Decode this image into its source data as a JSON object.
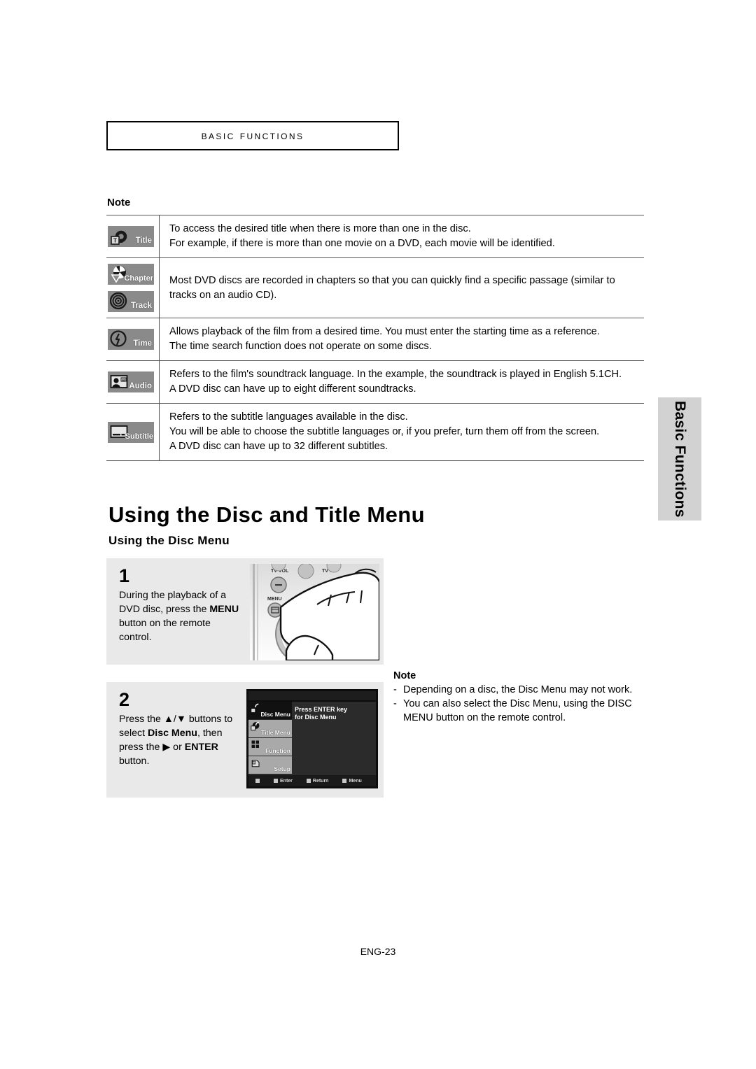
{
  "chapter": {
    "title": "Basic Functions"
  },
  "note_table": {
    "label": "Note",
    "rows": [
      {
        "icons": [
          {
            "name": "title-icon",
            "label": "Title"
          }
        ],
        "lines": [
          "To access the desired title when there is more than one in the disc.",
          "For example, if there is more than one movie on a DVD, each movie will be identified."
        ]
      },
      {
        "icons": [
          {
            "name": "chapter-icon",
            "label": "Chapter"
          },
          {
            "name": "track-icon",
            "label": "Track"
          }
        ],
        "lines": [
          "Most DVD discs are recorded in chapters so that you can quickly find a specific passage (similar to",
          "tracks on an audio CD)."
        ]
      },
      {
        "icons": [
          {
            "name": "time-icon",
            "label": "Time"
          }
        ],
        "lines": [
          "Allows playback of the film from a desired time. You must enter the starting time as a reference.",
          "The time search function does not operate on some discs."
        ]
      },
      {
        "icons": [
          {
            "name": "audio-icon",
            "label": "Audio"
          }
        ],
        "lines": [
          "Refers to the film's soundtrack language. In the example, the soundtrack is played in English 5.1CH.",
          "A DVD disc can have up to eight different soundtracks."
        ]
      },
      {
        "icons": [
          {
            "name": "subtitle-icon",
            "label": "Subtitle"
          }
        ],
        "lines": [
          "Refers to the subtitle languages available in the disc.",
          "You will be able to choose the subtitle languages or, if you prefer, turn them off from the screen.",
          "A DVD disc can have up to 32 different subtitles."
        ]
      }
    ]
  },
  "section": {
    "heading": "Using the Disc and Title Menu",
    "subheading": "Using the Disc Menu"
  },
  "steps": [
    {
      "number": "1",
      "text_parts": [
        {
          "t": "During the playback of a DVD disc, press the ",
          "b": false
        },
        {
          "t": "MENU",
          "b": true
        },
        {
          "t": " button on the remote control.",
          "b": false
        }
      ],
      "image_name": "remote-control-menu-button-photo",
      "remote_labels": {
        "tv_vol": "TV VOL",
        "tv_ch": "TV CH",
        "menu": "MENU"
      }
    },
    {
      "number": "2",
      "text_parts": [
        {
          "t": "Press the ",
          "b": false
        },
        {
          "t": "▲",
          "b": false
        },
        {
          "t": "/",
          "b": false
        },
        {
          "t": "▼",
          "b": false
        },
        {
          "t": " buttons to select ",
          "b": false
        },
        {
          "t": "Disc Menu",
          "b": true
        },
        {
          "t": ", then press the ",
          "b": false
        },
        {
          "t": "▶",
          "b": false
        },
        {
          "t": " or ",
          "b": false
        },
        {
          "t": "ENTER",
          "b": true
        },
        {
          "t": " button.",
          "b": false
        }
      ],
      "image_name": "dvd-osd-menu-screenshot"
    }
  ],
  "tv_menu": {
    "items": [
      {
        "label": "Disc Menu",
        "active": true,
        "icon": "disc-menu-icon"
      },
      {
        "label": "Title Menu",
        "active": false,
        "icon": "title-menu-icon"
      },
      {
        "label": "Function",
        "active": false,
        "icon": "function-icon"
      },
      {
        "label": "Setup",
        "active": false,
        "icon": "setup-icon"
      }
    ],
    "panel_lines": [
      "Press ENTER key",
      "for Disc Menu"
    ],
    "hints": [
      "Enter",
      "Return",
      "Menu"
    ]
  },
  "side_note": {
    "title": "Note",
    "items": [
      "Depending on a disc, the Disc Menu may not work.",
      "You can also select the Disc Menu, using the DISC MENU button on the remote control."
    ],
    "dash": "-"
  },
  "side_tab": {
    "label": "Basic Functions"
  },
  "footer": {
    "page": "ENG-23"
  }
}
